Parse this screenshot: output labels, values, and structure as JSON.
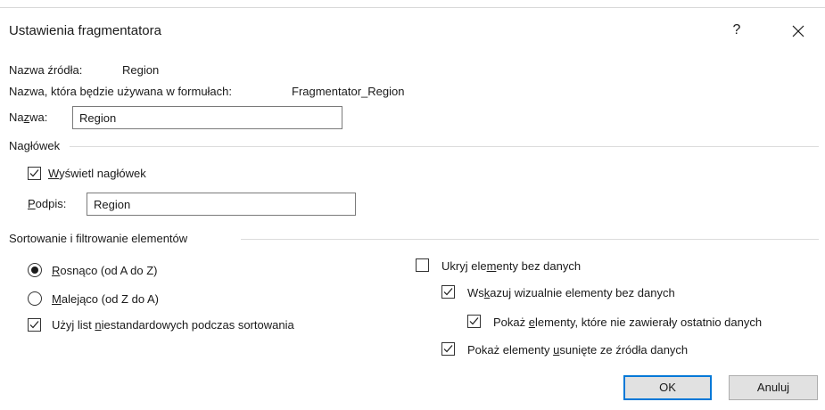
{
  "window": {
    "title": "Ustawienia fragmentatora",
    "help_label": "?"
  },
  "source": {
    "source_name_label": "Nazwa źródła:",
    "source_name_value": "Region",
    "formula_name_label": "Nazwa, która będzie używana w formułach:",
    "formula_name_value": "Fragmentator_Region",
    "name_label_pre": "Na",
    "name_label_ul": "z",
    "name_label_post": "wa:",
    "name_value": "Region"
  },
  "header_group": {
    "title": "Nagłówek",
    "show_header_ul": "W",
    "show_header_rest": "yświetl nagłówek",
    "show_header_checked": true,
    "caption_label_ul": "P",
    "caption_label_rest": "odpis:",
    "caption_value": "Region"
  },
  "sort_group": {
    "title": "Sortowanie i filtrowanie elementów",
    "asc_ul": "R",
    "asc_rest": "osnąco (od A do Z)",
    "asc_selected": true,
    "desc_ul": "M",
    "desc_rest": "alejąco (od Z do A)",
    "desc_selected": false,
    "custom_pre": "Użyj list ",
    "custom_ul": "n",
    "custom_post": "iestandardowych podczas sortowania",
    "custom_checked": true,
    "hide_pre": "Ukryj ele",
    "hide_ul": "m",
    "hide_post": "enty bez danych",
    "hide_checked": false,
    "indicate_pre": "Ws",
    "indicate_ul": "k",
    "indicate_post": "azuj wizualnie elementy bez danych",
    "indicate_checked": true,
    "show_last_pre": "Pokaż ",
    "show_last_ul": "e",
    "show_last_post": "lementy, które nie zawierały ostatnio danych",
    "show_last_checked": true,
    "show_deleted_pre": "Pokaż elementy ",
    "show_deleted_ul": "u",
    "show_deleted_post": "sunięte ze źródła danych",
    "show_deleted_checked": true
  },
  "buttons": {
    "ok": "OK",
    "cancel": "Anuluj"
  }
}
